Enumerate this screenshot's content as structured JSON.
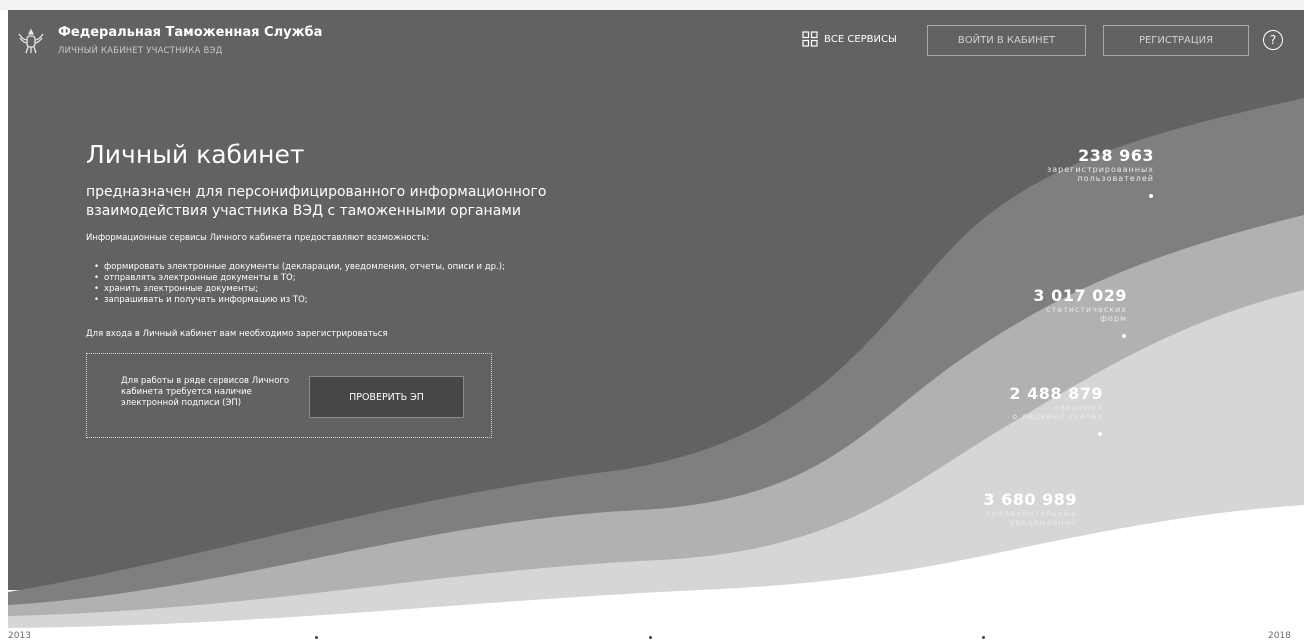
{
  "header": {
    "brand_title": "Федеральная Таможенная Служба",
    "brand_subtitle": "ЛИЧНЫЙ КАБИНЕТ УЧАСТНИКА ВЭД",
    "logo_icon": "eagle-emblem-icon",
    "services_label": "ВСЕ СЕРВИСЫ",
    "services_icon": "grid-icon",
    "login_label": "ВОЙТИ В КАБИНЕТ",
    "register_label": "РЕГИСТРАЦИЯ",
    "help_label": "?"
  },
  "main": {
    "title": "Личный кабинет",
    "subtitle": "предназначен для персонифицированного информационного взаимодействия участника ВЭД с таможенными органами",
    "intro": "Информационные сервисы Личного кабинета предоставляют возможность:",
    "bullets": [
      "формировать электронные документы (декларации, уведомления, отчеты, описи и др.);",
      "отправлять электронные документы в ТО;",
      "хранить электронные документы;",
      "запрашивать и получать информацию из ТО;"
    ],
    "register_note": "Для входа в Личный кабинет вам необходимо зарегистрироваться",
    "ep_text": "Для работы в ряде сервисов Личного кабинета требуется наличие электронной подписи (ЭП)",
    "ep_button": "ПРОВЕРИТЬ ЭП"
  },
  "stats": [
    {
      "number": "238 963",
      "label_line1": "зарегистрированных",
      "label_line2": "пользователей"
    },
    {
      "number": "3 017 029",
      "label_line1": "статистических",
      "label_line2": "форм"
    },
    {
      "number": "2 488 879",
      "label_line1": "сведений",
      "label_line2": "о лицевых счетах"
    },
    {
      "number": "3 680 989",
      "label_line1": "предварительных",
      "label_line2": "уведомлений"
    }
  ],
  "timeline": {
    "start_year": "2013",
    "end_year": "2018"
  },
  "colors": {
    "background_dark": "#626262",
    "wave_1": "#7f7f7f",
    "wave_2": "#b1b1b1",
    "wave_3": "#d6d6d6",
    "ep_button_bg": "#474747"
  }
}
